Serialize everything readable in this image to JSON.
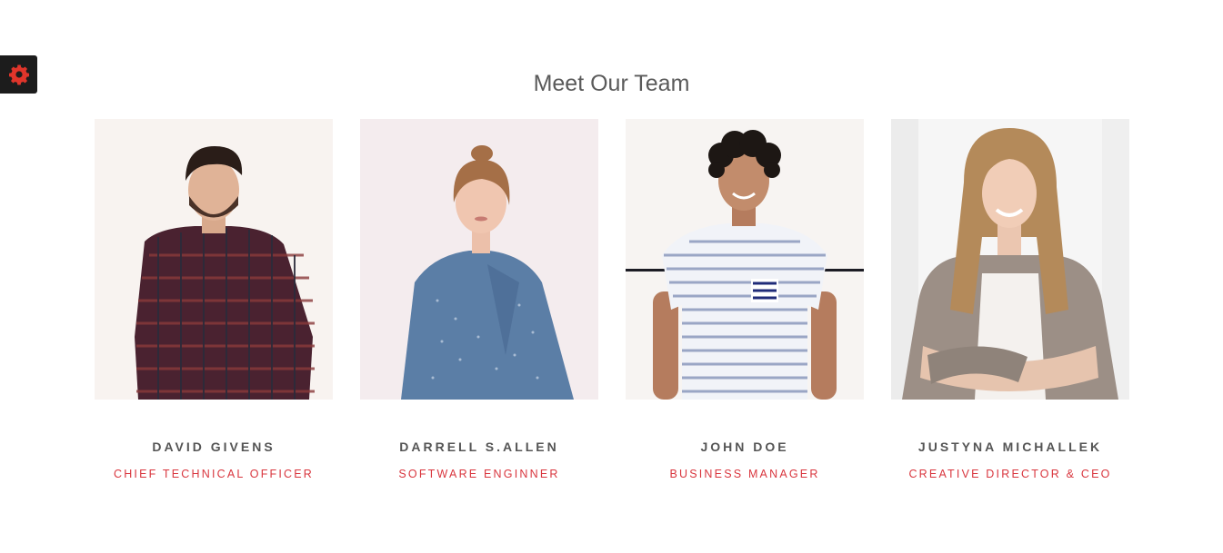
{
  "settings": {
    "icon": "gear-icon",
    "color": "#e0352b",
    "background": "#1c1c1c"
  },
  "section": {
    "title": "Meet Our Team"
  },
  "colors": {
    "accent": "#d9363e",
    "name": "#555555",
    "title": "#5a5a5a"
  },
  "team": [
    {
      "name": "DAVID GIVENS",
      "role": "CHIEF TECHNICAL OFFICER"
    },
    {
      "name": "DARRELL S.ALLEN",
      "role": "SOFTWARE ENGINNER"
    },
    {
      "name": "JOHN DOE",
      "role": "BUSINESS MANAGER"
    },
    {
      "name": "JUSTYNA MICHALLEK",
      "role": "CREATIVE DIRECTOR & CEO"
    }
  ]
}
